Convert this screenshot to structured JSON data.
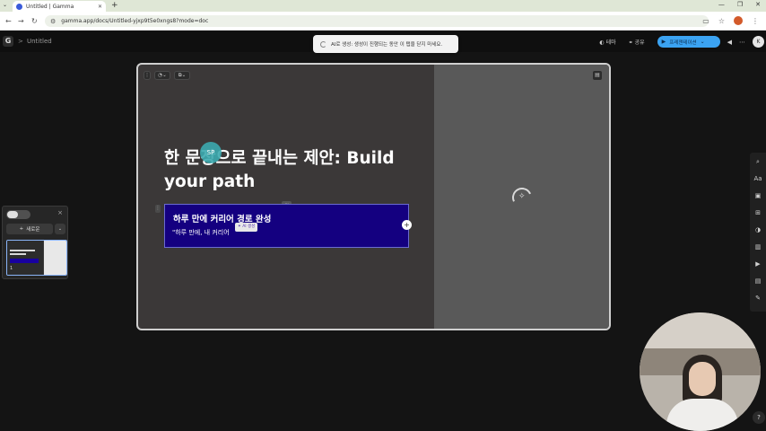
{
  "browser": {
    "tab_title": "Untitled | Gamma",
    "new_tab": "+",
    "url": "gamma.app/docs/Untitled-yjxp9t5e0xngs8?mode=doc"
  },
  "header": {
    "logo": "G",
    "breadcrumb_sep": ">",
    "doc_title": "Untitled",
    "toast_text": "AI로 생성: 생성이 진행되는 동안 이 탭을 닫지 마세요.",
    "theme_label": "테마",
    "share_label": "공유",
    "present_label": "프레젠테이션",
    "avatar_initial": "K"
  },
  "left_panel": {
    "new_button_label": "새로운",
    "thumb_number": "1"
  },
  "slide": {
    "title": "한 문장으로 끝내는 제안: Build your path",
    "callout_heading": "하루 만에 커리어 경로 완성",
    "callout_text": "\"하루 만에, 내 커리어",
    "ai_chip_label": "AI 생성",
    "cursor_label": "SP",
    "add_button": "+"
  },
  "colors": {
    "callout_bg": "#140080",
    "present_button": "#3ba3f2",
    "card_border": "#cfcfcf"
  },
  "icons": {
    "toolbar": [
      "search-icon",
      "text-icon",
      "image-icon",
      "grid-icon",
      "toggle-icon",
      "chart-icon",
      "video-icon",
      "table-icon",
      "edit-icon"
    ]
  }
}
